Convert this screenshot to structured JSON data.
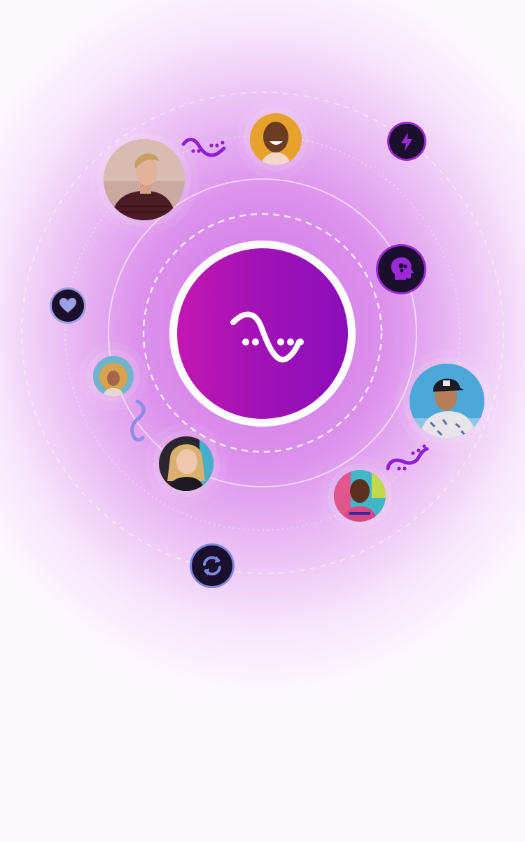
{
  "logo": {
    "icon": "wave-logo-icon",
    "color": "#ffffff",
    "gradient": [
      "#c217b0",
      "#8a0eb8"
    ]
  },
  "avatars": [
    {
      "id": "man-sweater",
      "icon": "avatar-photo"
    },
    {
      "id": "woman-laughing",
      "icon": "avatar-photo"
    },
    {
      "id": "woman-curly-hair",
      "icon": "avatar-photo"
    },
    {
      "id": "woman-blonde",
      "icon": "avatar-photo"
    },
    {
      "id": "man-cap",
      "icon": "avatar-photo"
    },
    {
      "id": "man-colorful-shirt",
      "icon": "avatar-photo"
    }
  ],
  "badges": [
    {
      "icon": "lightning-icon",
      "color": "#9b2ad6"
    },
    {
      "icon": "brain-head-icon",
      "color": "#9b2ad6"
    },
    {
      "icon": "heart-icon",
      "color": "#9aa0e0"
    },
    {
      "icon": "refresh-icon",
      "color": "#7d86e0"
    }
  ],
  "colors": {
    "accent": "#9b1fd0",
    "badge_bg": "#1b0f2e",
    "wave_purple": "#8f1fd6",
    "wave_blue": "#8e8ce6"
  }
}
